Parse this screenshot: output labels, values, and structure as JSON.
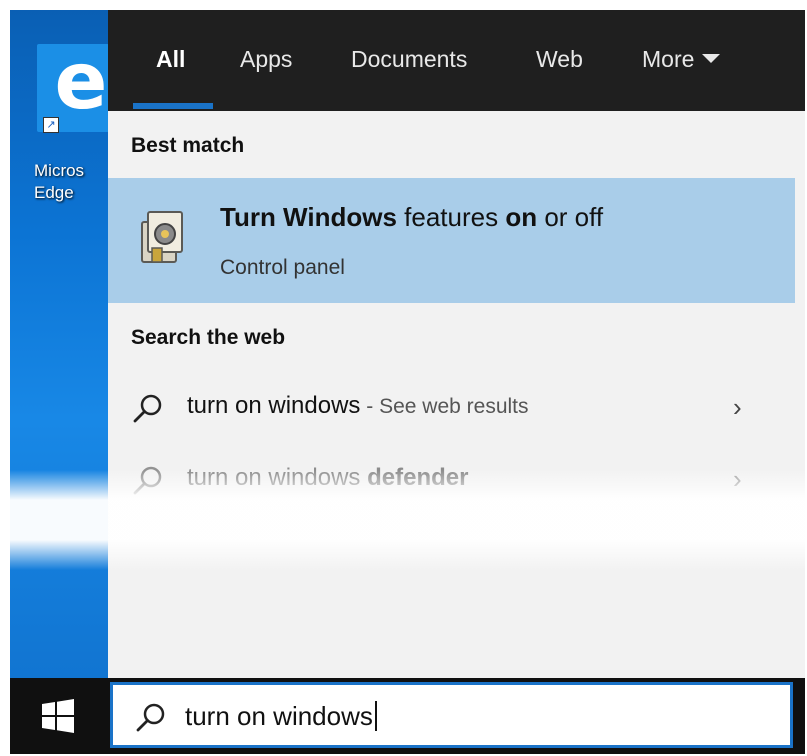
{
  "desktop": {
    "icon_label": "Micros\nEdge",
    "icon_name": "edge-icon"
  },
  "tabs": [
    {
      "label": "All",
      "active": true
    },
    {
      "label": "Apps",
      "active": false
    },
    {
      "label": "Documents",
      "active": false
    },
    {
      "label": "Web",
      "active": false
    },
    {
      "label": "More",
      "active": false
    }
  ],
  "best_match": {
    "heading": "Best match",
    "title_part1": "Turn Windows",
    "title_part2": " features ",
    "title_part3": "on",
    "title_part4": " or off",
    "subtitle": "Control panel",
    "icon_name": "windows-features-icon"
  },
  "search_web": {
    "heading": "Search the web",
    "results": [
      {
        "query": "turn on windows",
        "hint": " - See web results"
      },
      {
        "query_plain": "turn on windows ",
        "query_bold": "defender"
      }
    ]
  },
  "taskbar": {
    "search_value": "turn on windows",
    "start_icon": "windows-logo-icon"
  },
  "colors": {
    "accent": "#1a73c8",
    "tab_bar": "#1f1f1f",
    "highlight": "#a9cde9",
    "taskbar": "#101010"
  }
}
